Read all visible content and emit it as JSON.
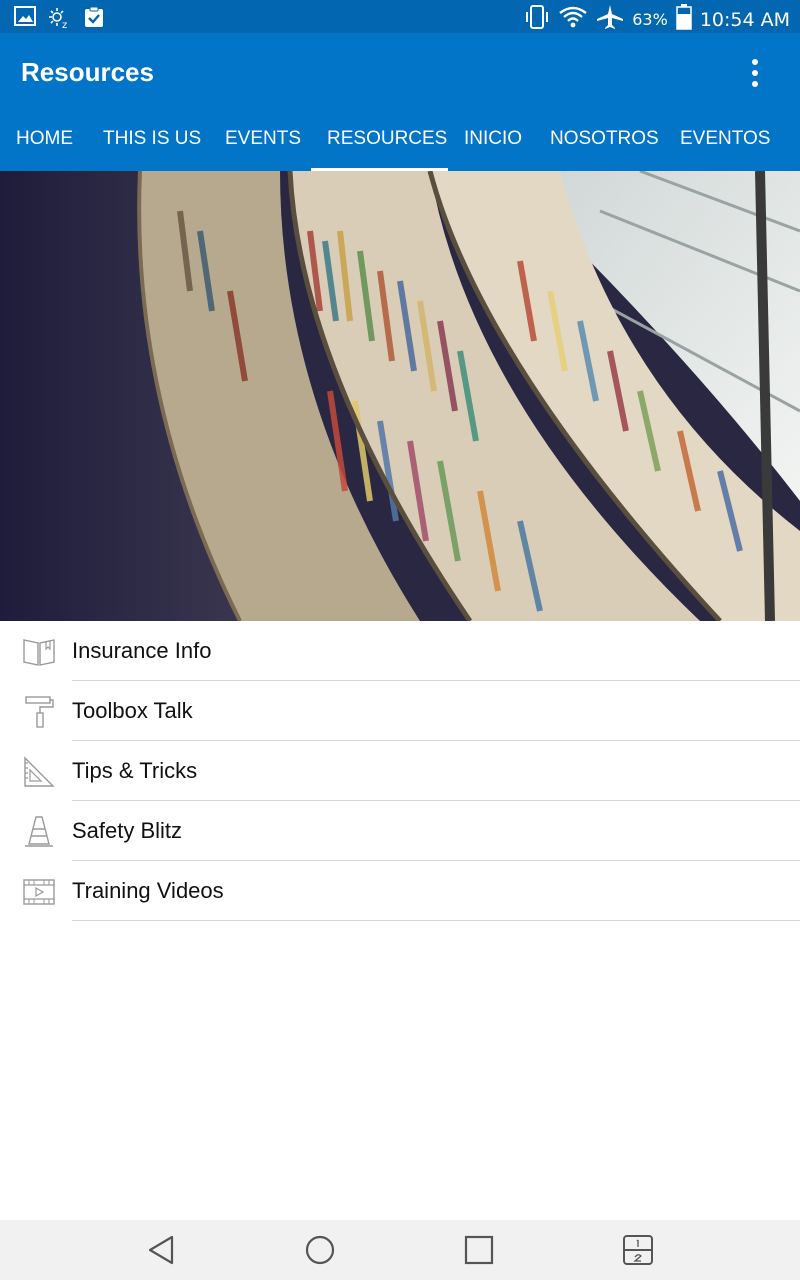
{
  "status_bar": {
    "battery_percent": "63%",
    "time": "10:54 AM",
    "left_icons": [
      "image-icon",
      "sleep-icon",
      "clipboard-check-icon"
    ],
    "right_icons": [
      "vibrate-icon",
      "wifi-icon",
      "airplane-icon",
      "battery-icon"
    ]
  },
  "app_bar": {
    "title": "Resources",
    "menu_icon": "more-vert-icon",
    "background": "#0275c8",
    "status_background": "#0266b0"
  },
  "tabs": [
    {
      "label": "HOME"
    },
    {
      "label": "THIS IS US"
    },
    {
      "label": "EVENTS"
    },
    {
      "label": "RESOURCES",
      "active": true
    },
    {
      "label": "INICIO"
    },
    {
      "label": "NOSOTROS"
    },
    {
      "label": "EVENTOS"
    }
  ],
  "list": [
    {
      "label": "Insurance Info",
      "icon": "open-book-icon"
    },
    {
      "label": "Toolbox Talk",
      "icon": "paint-roller-icon"
    },
    {
      "label": "Tips & Tricks",
      "icon": "set-square-icon"
    },
    {
      "label": "Safety Blitz",
      "icon": "traffic-cone-icon"
    },
    {
      "label": "Training Videos",
      "icon": "video-film-icon"
    }
  ],
  "nav_bar": {
    "buttons": [
      "back-icon",
      "home-icon",
      "recents-icon",
      "dual-window-icon"
    ]
  }
}
